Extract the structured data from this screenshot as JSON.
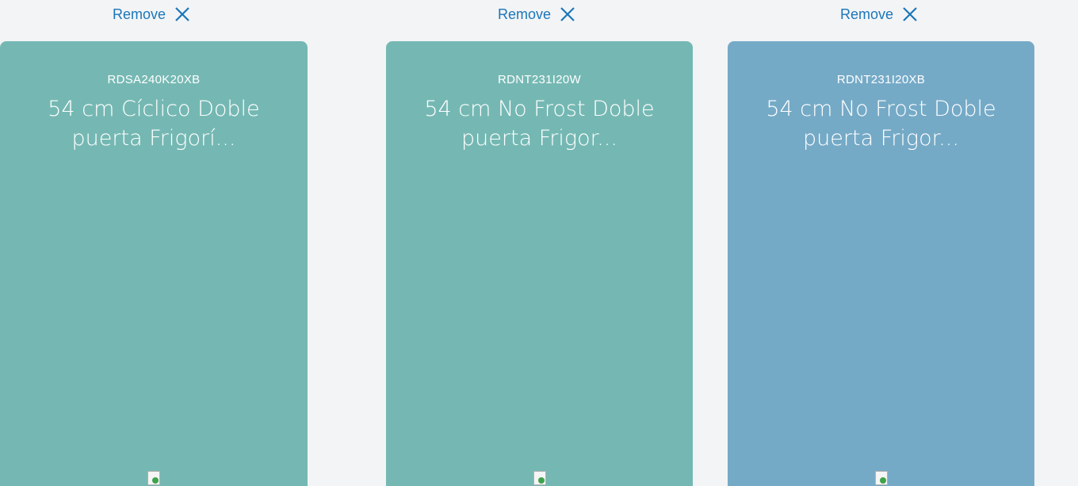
{
  "cards": [
    {
      "remove_label": "Remove",
      "code": "RDSA240K20XB",
      "title": "54 cm Cíclico Doble puerta Frigorí...",
      "color": "#75b8b3"
    },
    {
      "remove_label": "Remove",
      "code": "RDNT231I20W",
      "title": "54 cm No Frost Doble puerta Frigor...",
      "color": "#75b8b3"
    },
    {
      "remove_label": "Remove",
      "code": "RDNT231I20XB",
      "title": "54 cm No Frost Doble puerta Frigor...",
      "color": "#75aac7"
    }
  ],
  "colors": {
    "link": "#1b76b8",
    "background": "#f3f4f6"
  },
  "icons": {
    "remove": "close-icon",
    "image": "broken-image-icon"
  }
}
